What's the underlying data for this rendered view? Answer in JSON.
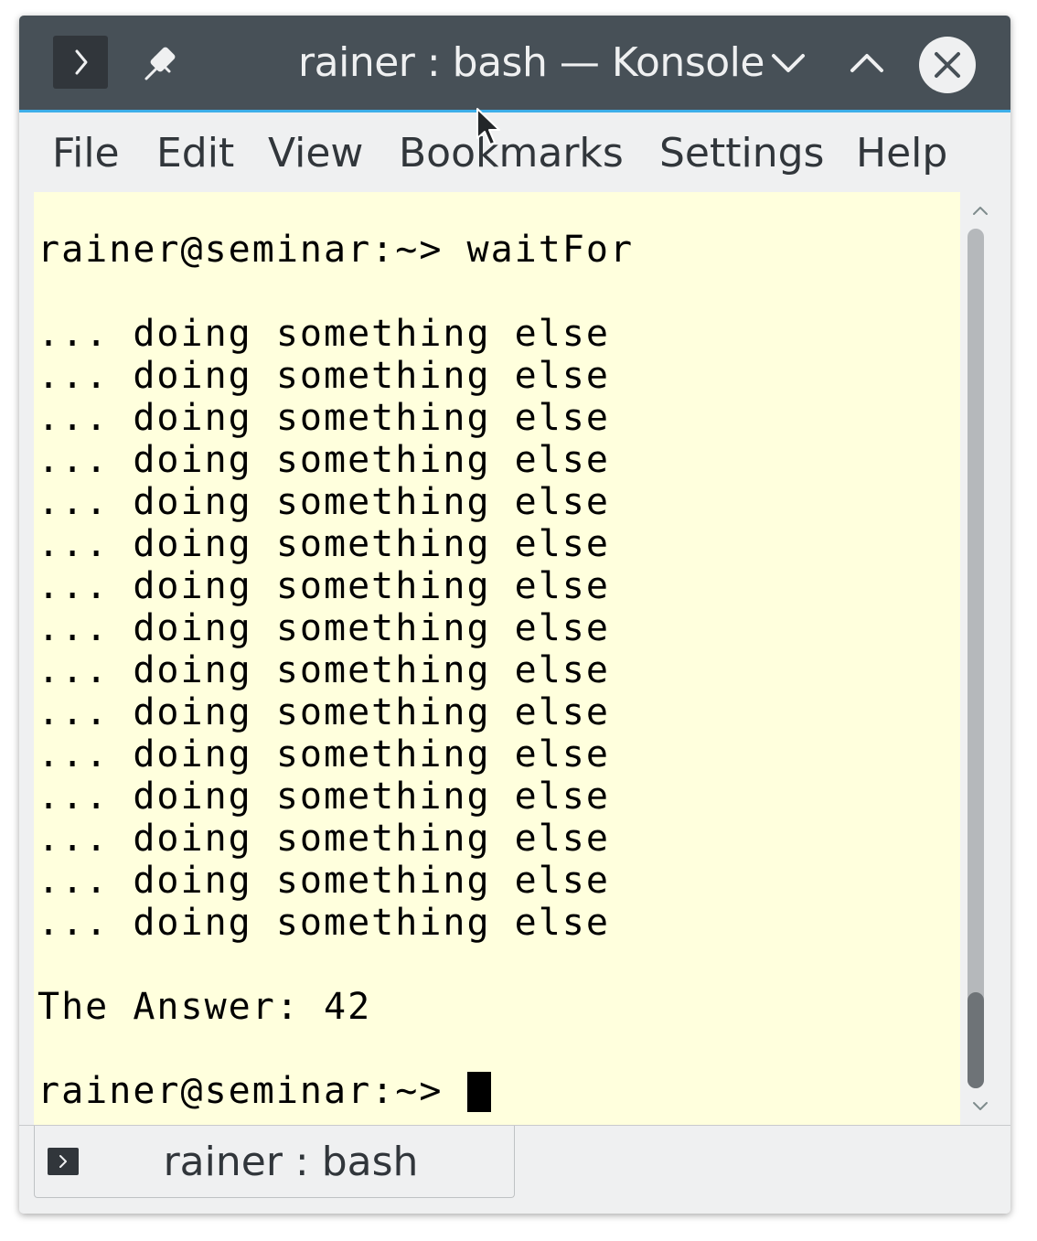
{
  "window": {
    "title": "rainer : bash — Konsole",
    "icons": [
      "terminal-app-icon",
      "pin-icon",
      "minimize-chevron-icon",
      "maximize-chevron-icon",
      "close-icon"
    ]
  },
  "menu": {
    "file": "File",
    "edit": "Edit",
    "view": "View",
    "bookmarks": "Bookmarks",
    "settings": "Settings",
    "help": "Help"
  },
  "terminal": {
    "background": "#ffffdd",
    "prompt": "rainer@seminar:~>",
    "command": "waitFor",
    "output_lines": [
      "... doing something else",
      "... doing something else",
      "... doing something else",
      "... doing something else",
      "... doing something else",
      "... doing something else",
      "... doing something else",
      "... doing something else",
      "... doing something else",
      "... doing something else",
      "... doing something else",
      "... doing something else",
      "... doing something else",
      "... doing something else",
      "... doing something else"
    ],
    "result": "The Answer: 42",
    "final_prompt": "rainer@seminar:~>"
  },
  "tabs": [
    {
      "label": "rainer : bash"
    }
  ],
  "colors": {
    "titlebar": "#475057",
    "accent": "#3daee9",
    "chrome": "#eff0f1"
  }
}
